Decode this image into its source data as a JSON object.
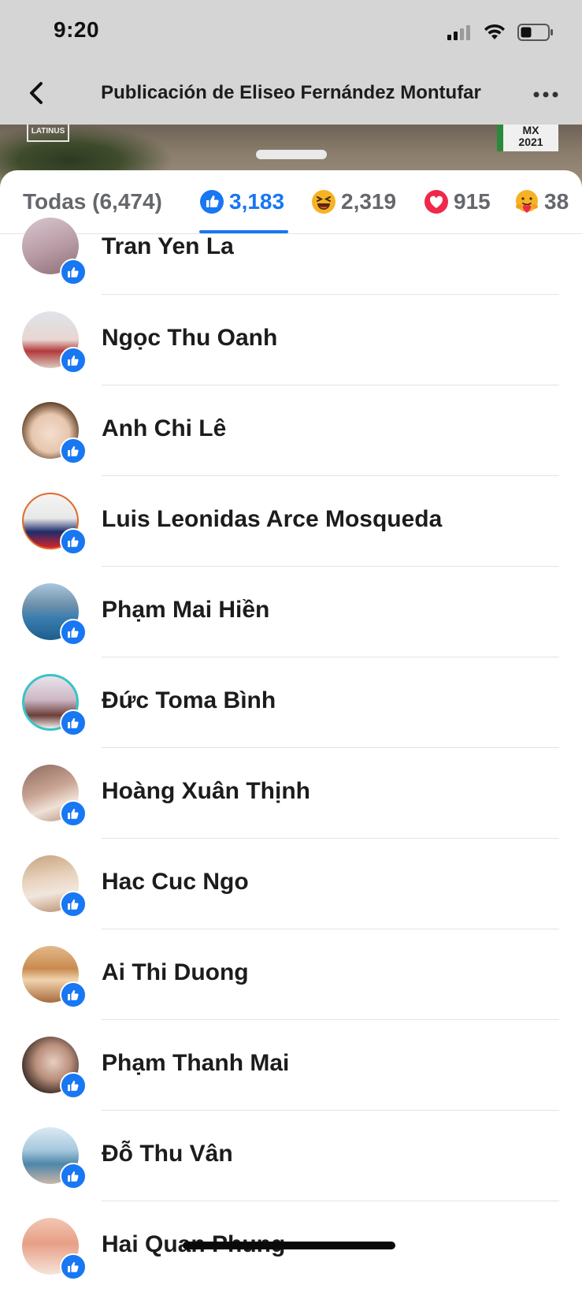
{
  "status_bar": {
    "time": "9:20"
  },
  "header": {
    "title": "Publicación de Eliseo Fernández Montufar"
  },
  "backdrop": {
    "left_logo": "LATINUS",
    "right_logo_line1": "MX",
    "right_logo_line2": "2021"
  },
  "tabs": [
    {
      "label": "Todas (6,474)",
      "icon": "none",
      "active": false
    },
    {
      "label": "3,183",
      "icon": "like-icon",
      "active": true
    },
    {
      "label": "2,319",
      "icon": "haha-icon",
      "active": false
    },
    {
      "label": "915",
      "icon": "love-icon",
      "active": false
    },
    {
      "label": "38",
      "icon": "care-icon",
      "active": false
    }
  ],
  "people": [
    {
      "name": "Tran Yen La"
    },
    {
      "name": "Ngọc Thu Oanh"
    },
    {
      "name": "Anh Chi Lê"
    },
    {
      "name": "Luis Leonidas Arce Mosqueda"
    },
    {
      "name": "Phạm Mai Hiền"
    },
    {
      "name": "Đức Toma Bình"
    },
    {
      "name": "Hoàng Xuân Thịnh"
    },
    {
      "name": "Hac Cuc Ngo"
    },
    {
      "name": "Ai Thi Duong"
    },
    {
      "name": "Phạm Thanh Mai"
    },
    {
      "name": "Đỗ Thu Vân"
    },
    {
      "name": "Hai Quan Phung"
    }
  ],
  "colors": {
    "accent": "#1877f2",
    "header_bg": "#d5d5d5",
    "muted_text": "#65676b"
  }
}
